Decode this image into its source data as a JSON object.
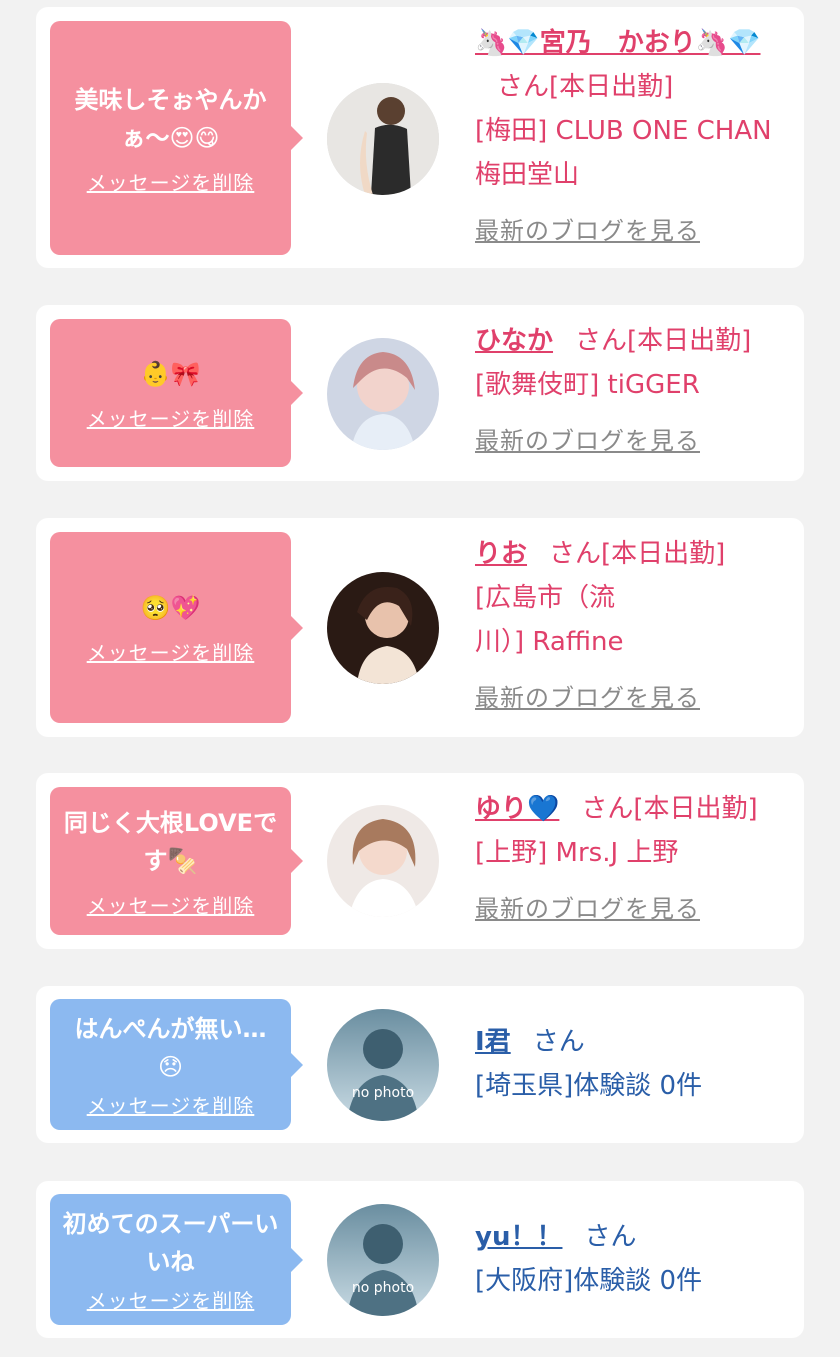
{
  "delete_label": "メッセージを削除",
  "blog_label": "最新のブログを見る",
  "san_label": "さん",
  "cards": [
    {
      "message": "美味しそぉやんかぁ〜😍😋",
      "name": "🦄💎宮乃　かおり🦄💎",
      "status": "[本日出勤]",
      "shop": "[梅田] CLUB ONE CHAN 梅田堂山",
      "show_blog": true
    },
    {
      "message": "👶🎀",
      "name": "ひなか",
      "status": "[本日出勤]",
      "shop": "[歌舞伎町] tiGGER",
      "show_blog": true
    },
    {
      "message": "🥺💖",
      "name": "りお",
      "status": "[本日出勤]",
      "shop": "[広島市（流川）] Raffine",
      "show_blog": true
    },
    {
      "message": "同じく大根LOVEです🍢",
      "name": "ゆり💙",
      "status": "[本日出勤]",
      "shop": "[上野] Mrs.J 上野",
      "show_blog": true
    },
    {
      "message": "はんぺんが無い…😞",
      "name": "I君",
      "status": "",
      "shop": "[埼玉県]体験談 0件",
      "show_blog": false
    },
    {
      "message": "初めてのスーパーいいね",
      "name": "yu！！",
      "status": "",
      "shop": "[大阪府]体験談 0件",
      "show_blog": false
    }
  ],
  "no_photo_label": "no photo",
  "colors": {
    "pink": "#f5909f",
    "blue": "#8cb9f0",
    "name_pink": "#e0406b",
    "name_blue": "#2a5ea8"
  }
}
